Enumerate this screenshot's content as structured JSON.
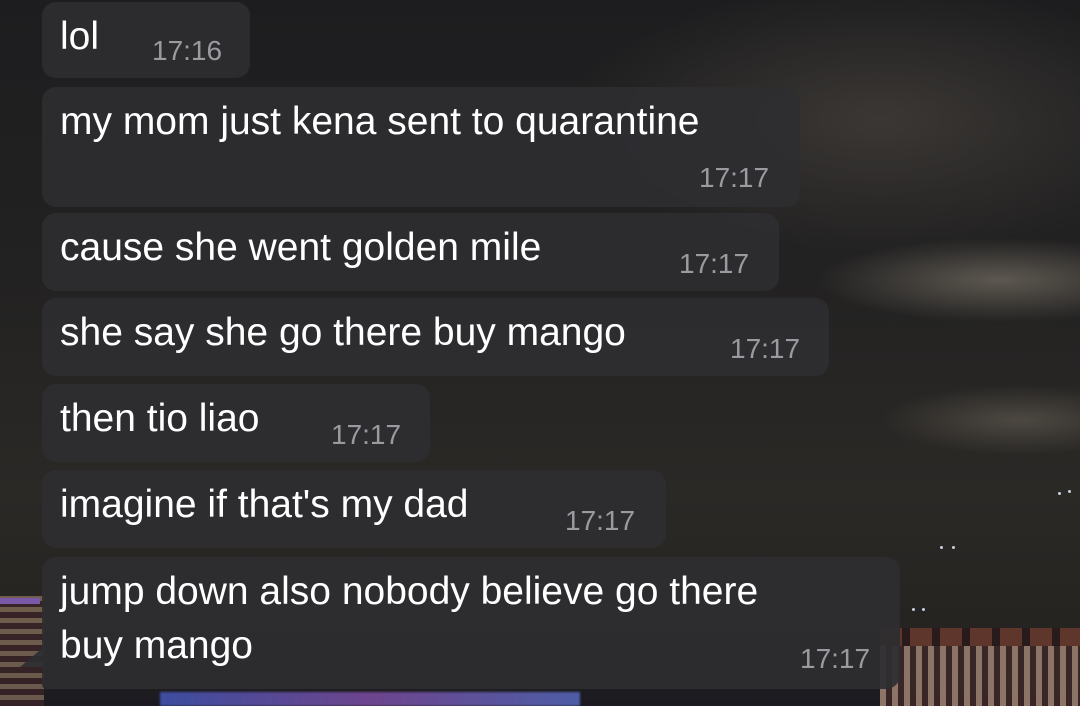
{
  "messages": [
    {
      "text": "lol",
      "time": "17:16"
    },
    {
      "text": "my mom just kena sent to quarantine",
      "time": "17:17"
    },
    {
      "text": "cause she went golden mile",
      "time": "17:17"
    },
    {
      "text": "she say she go there buy mango",
      "time": "17:17"
    },
    {
      "text": "then tio liao",
      "time": "17:17"
    },
    {
      "text": "imagine if that's my dad",
      "time": "17:17"
    },
    {
      "text_line1": "jump down also nobody believe go there",
      "text_line2": "buy mango",
      "time": "17:17"
    }
  ],
  "theme": {
    "bubble_color": "#2e2e31",
    "text_color": "#ffffff",
    "timestamp_color": "#9a9aa0"
  }
}
